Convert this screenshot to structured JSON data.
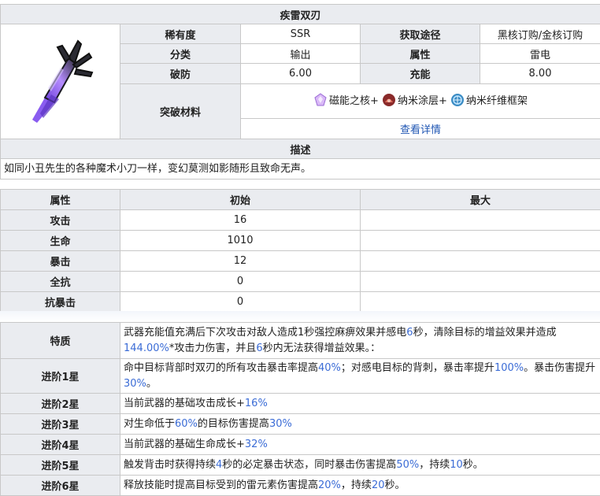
{
  "weapon": {
    "title": "疾雷双刃",
    "icon": "purple-twin-blades-icon",
    "rarity_label": "稀有度",
    "rarity": "SSR",
    "source_label": "获取途径",
    "source": "黑核订购/金核订购",
    "category_label": "分类",
    "category": "输出",
    "attribute_label": "属性",
    "attribute": "雷电",
    "penetration_label": "破防",
    "penetration": "6.00",
    "charge_label": "充能",
    "charge": "8.00",
    "materials_label": "突破材料",
    "materials": [
      {
        "name": "磁能之核+",
        "icon": "magnetic-core-icon"
      },
      {
        "name": "纳米涂层+",
        "icon": "nano-coating-icon"
      },
      {
        "name": "纳米纤维框架",
        "icon": "nanofiber-frame-icon"
      }
    ],
    "details_link": "查看详情",
    "desc_label": "描述",
    "description": "如同小丑先生的各种魔术小刀一样，变幻莫测如影随形且致命无声。"
  },
  "stats": {
    "headers": [
      "属性",
      "初始",
      "最大"
    ],
    "rows": [
      {
        "name": "攻击",
        "initial": "16",
        "max": ""
      },
      {
        "name": "生命",
        "initial": "1010",
        "max": ""
      },
      {
        "name": "暴击",
        "initial": "12",
        "max": ""
      },
      {
        "name": "全抗",
        "initial": "0",
        "max": ""
      },
      {
        "name": "抗暴击",
        "initial": "0",
        "max": ""
      }
    ]
  },
  "traits": {
    "trait_label": "特质",
    "trait_parts": [
      "武器充能值充满后下次攻击对敌人造成1秒强控麻痹效果并感电",
      "6",
      "秒，清除目标的增益效果并造成",
      "144.00%",
      "*攻击力伤害，并且",
      "6",
      "秒内无法获得增益效果。："
    ],
    "advances": [
      {
        "label": "进阶1星",
        "parts": [
          "命中目标背部时双刃的所有攻击暴击率提高",
          "40%",
          "；对感电目标的背刺，暴击率提升",
          "100%",
          "。暴击伤害提升",
          "30%",
          "。"
        ]
      },
      {
        "label": "进阶2星",
        "parts": [
          "当前武器的基础攻击成长+",
          "16%"
        ]
      },
      {
        "label": "进阶3星",
        "parts": [
          "对生命低于",
          "60%",
          "的目标伤害提高",
          "30%"
        ]
      },
      {
        "label": "进阶4星",
        "parts": [
          "当前武器的基础生命成长+",
          "32%"
        ]
      },
      {
        "label": "进阶5星",
        "parts": [
          "触发背击时获得持续",
          "4",
          "秒的必定暴击状态，同时暴击伤害提高",
          "50%",
          "，持续",
          "10",
          "秒。"
        ]
      },
      {
        "label": "进阶6星",
        "parts": [
          "释放技能时提高目标受到的雷元素伤害提高",
          "20%",
          "，持续",
          "20",
          "秒。"
        ]
      }
    ]
  }
}
